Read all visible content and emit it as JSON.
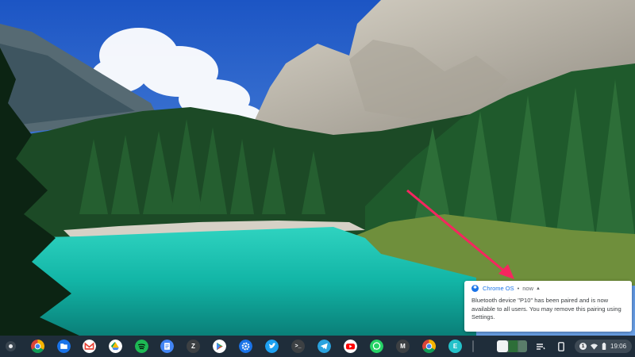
{
  "wallpaper": {
    "sky": "#2f6fd6",
    "lake": "#17c4b0",
    "forest": "#1f5a2c",
    "rock": "#b9b4a8"
  },
  "notification": {
    "app_name": "Chrome OS",
    "separator": "•",
    "time": "now",
    "message": "Bluetooth device \"P10\" has been paired and is now available to all users. You may remove this pairing using Settings."
  },
  "annotation": {
    "color": "#f5265f"
  },
  "shelf": {
    "apps": [
      {
        "name": "chrome-icon"
      },
      {
        "name": "files-icon"
      },
      {
        "name": "gmail-icon"
      },
      {
        "name": "google-drive-icon"
      },
      {
        "name": "spotify-icon"
      },
      {
        "name": "google-docs-icon"
      },
      {
        "name": "zoom-icon",
        "letter": "Z"
      },
      {
        "name": "play-store-icon"
      },
      {
        "name": "settings-icon"
      },
      {
        "name": "twitter-icon"
      },
      {
        "name": "terminal-icon",
        "letter": ">_"
      },
      {
        "name": "telegram-icon"
      },
      {
        "name": "youtube-icon"
      },
      {
        "name": "whatsapp-icon"
      },
      {
        "name": "m-app-icon",
        "letter": "M"
      },
      {
        "name": "chrome-beta-icon"
      },
      {
        "name": "e-app-icon",
        "letter": "E"
      }
    ],
    "tray": {
      "notification_count": "1",
      "time": "19:06"
    }
  }
}
